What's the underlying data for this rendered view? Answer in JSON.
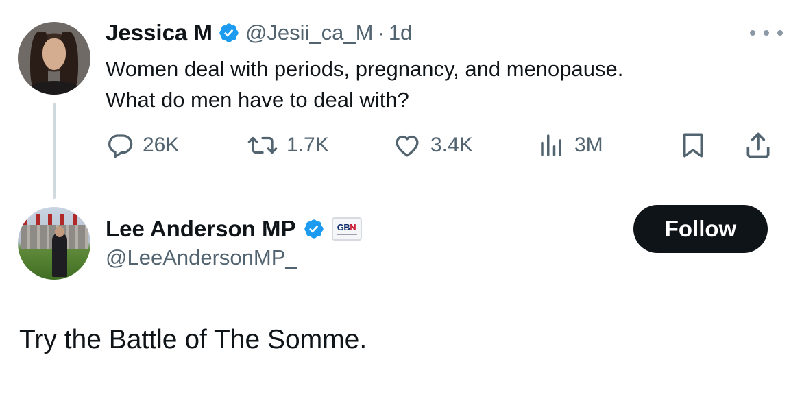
{
  "parent_tweet": {
    "author_name": "Jessica M",
    "handle": "@Jesii_ca_M",
    "separator": "·",
    "time": "1d",
    "verified_icon": "verified-badge-icon",
    "more_icon": "more-horizontal-icon",
    "text_lines": [
      "Women deal with periods, pregnancy, and menopause.",
      "What do men have to deal with?"
    ],
    "actions": {
      "replies": "26K",
      "retweets": "1.7K",
      "likes": "3.4K",
      "views": "3M"
    }
  },
  "reply_tweet": {
    "author_name": "Lee Anderson MP",
    "handle": "@LeeAndersonMP_",
    "verified_icon": "verified-badge-icon",
    "affiliation_badge": {
      "label": "GB",
      "label_accent": "N"
    },
    "follow_label": "Follow",
    "text": "Try the Battle of The Somme."
  },
  "colors": {
    "primary_text": "#0f1419",
    "secondary_text": "#536471",
    "verified_blue": "#1d9bf0",
    "follow_bg": "#0f1419",
    "follow_text": "#ffffff",
    "thread_line": "#cfd9de"
  }
}
